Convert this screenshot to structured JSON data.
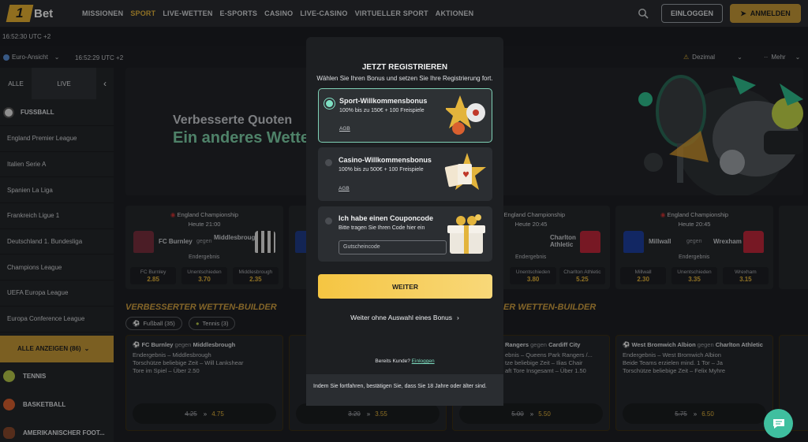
{
  "nav": {
    "logo_number": "1",
    "logo_text": "Bet",
    "items": [
      "MISSIONEN",
      "SPORT",
      "LIVE-WETTEN",
      "E-SPORTS",
      "CASINO",
      "LIVE-CASINO",
      "VIRTUELLER SPORT",
      "AKTIONEN"
    ],
    "active": "SPORT",
    "login_label": "EINLOGGEN",
    "signup_label": "ANMELDEN",
    "accent": "#c79a38"
  },
  "time_top": "16:52:30 UTC +2",
  "subbar": {
    "view": "Euro-Ansicht",
    "time": "16:52:29 UTC +2",
    "odds_format": "Dezimal",
    "more": "Mehr"
  },
  "sidebar": {
    "tabs": [
      "ALLE",
      "LIVE"
    ],
    "section": "FUSSBALL",
    "leagues": [
      "England Premier League",
      "Italien Serie A",
      "Spanien La Liga",
      "Frankreich Ligue 1",
      "Deutschland 1. Bundesliga",
      "Champions League",
      "UEFA Europa League",
      "Europa Conference League"
    ],
    "show_all": "ALLE ANZEIGEN (86)",
    "sports": [
      "TENNIS",
      "BASKETBALL",
      "AMERIKANISCHER FOOT..."
    ]
  },
  "banner": {
    "line1": "Verbesserte Quoten",
    "line2": "Ein anderes Wette"
  },
  "matches": [
    {
      "league": "England Championship",
      "time": "Heute 21:00",
      "home": "FC Burnley",
      "vs": "gegen",
      "away": "Middlesbrough",
      "market": "Endergebnis",
      "odds": [
        {
          "label": "FC Burnley",
          "value": "2.85"
        },
        {
          "label": "Unentschieden",
          "value": "3.70"
        },
        {
          "label": "Middlesbrough",
          "value": "2.35"
        }
      ]
    },
    {
      "league": "England Championship",
      "time": "Heute 20:45",
      "away": "Charlton Athletic",
      "market": "Endergebnis",
      "odds": [
        {
          "label": "Unentschieden",
          "value": "3.80"
        },
        {
          "label": "Charlton Athletic",
          "value": "5.25"
        }
      ]
    },
    {
      "league": "England Championship",
      "time": "Heute 20:45",
      "home": "Millwall",
      "vs": "gegen",
      "away": "Wrexham",
      "market": "Endergebnis",
      "odds": [
        {
          "label": "Millwall",
          "value": "2.30"
        },
        {
          "label": "Unentschieden",
          "value": "3.35"
        },
        {
          "label": "Wrexham",
          "value": "3.15"
        }
      ]
    }
  ],
  "builder_section": {
    "title_left": "VERBESSERTER WETTEN-BUILDER",
    "title_right": "ER WETTEN-BUILDER",
    "pill_football": "Fußball (35)",
    "pill_tennis": "Tennis (3)"
  },
  "builders": [
    {
      "home": "FC Burnley",
      "vs": "gegen",
      "away": "Middlesbrough",
      "lines": [
        "Endergebnis – Middlesbrough",
        "Torschütze beliebige Zeit – Will Lankshear",
        "Tore im Spiel – Über 2.50"
      ],
      "old": "4.25",
      "new": "4.75"
    },
    {
      "home": "Rangers",
      "vs": "gegen",
      "away": "Cardiff City",
      "lines": [
        "ebnis – Queens Park Rangers /...",
        "tze beliebige Zeit – Ilias Chair",
        "aft Tore Insgesamt – Über 1.50"
      ],
      "old": "5.00",
      "new": "5.50"
    },
    {
      "home": "West Bromwich Albion",
      "vs": "gegen",
      "away": "Charlton Athletic",
      "lines": [
        "Endergebnis – West Bromwich Albion",
        "Beide Teams erzielen mind. 1 Tor – Ja",
        "Torschütze beliebige Zeit – Felix Myhre"
      ],
      "old": "5.75",
      "new": "6.50"
    }
  ],
  "middle_builder": {
    "old": "3.20",
    "new": "3.55"
  },
  "modal": {
    "title": "JETZT REGISTRIEREN",
    "subtitle": "Wählen Sie Ihren Bonus und setzen Sie Ihre Registrierung fort.",
    "options": [
      {
        "title": "Sport-Willkommensbonus",
        "desc": "100% bis zu 150€ + 100 Freispiele",
        "agb": "AGB",
        "selected": true
      },
      {
        "title": "Casino-Willkommensbonus",
        "desc": "100% bis zu 500€ + 100 Freispiele",
        "agb": "AGB",
        "selected": false
      },
      {
        "title": "Ich habe einen Couponcode",
        "desc": "Bitte tragen Sie Ihren Code hier ein",
        "selected": false
      }
    ],
    "coupon_placeholder": "Gutscheincode",
    "continue_label": "WEITER",
    "skip_label": "Weiter ohne Auswahl eines Bonus",
    "already_text": "Bereits Kunde?",
    "already_link": "Einloggen",
    "footer": "Indem Sie fortfahren, bestätigen Sie, dass Sie 18 Jahre oder älter sind."
  }
}
